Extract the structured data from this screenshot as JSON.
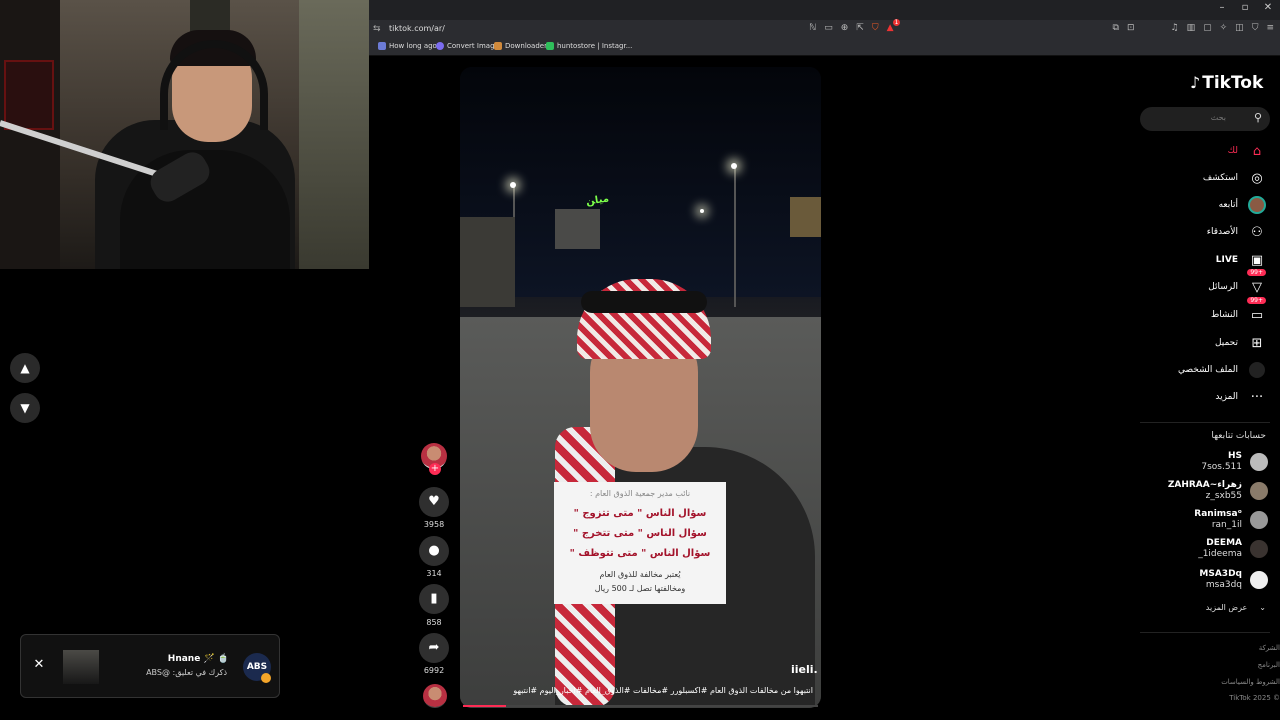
{
  "browser": {
    "url": "tiktok.com/ar/",
    "window_controls": [
      "–",
      "▫",
      "✕"
    ],
    "tab_badge": "1",
    "bookmarks": [
      {
        "label": "How long ago",
        "color": "#6c7bd6"
      },
      {
        "label": "Convert Image",
        "color": "#7b6cf0"
      },
      {
        "label": "Downloader",
        "color": "#d08a3c"
      },
      {
        "label": "huntostore | Instagr...",
        "color": "#2fbf5b"
      }
    ]
  },
  "sidebar": {
    "logo": "TikTok",
    "search_placeholder": "بحث",
    "nav": [
      {
        "label": "لك",
        "icon": "home-icon",
        "glyph": "⌂",
        "active": true
      },
      {
        "label": "استكشف",
        "icon": "compass-icon",
        "glyph": "◎"
      },
      {
        "label": "أتابعه",
        "icon": "following-avatar-icon",
        "glyph": "●"
      },
      {
        "label": "الأصدقاء",
        "icon": "friends-icon",
        "glyph": "👥"
      },
      {
        "label": "LIVE",
        "icon": "live-icon",
        "glyph": "▣"
      },
      {
        "label": "الرسائل",
        "icon": "messages-icon",
        "glyph": "▽",
        "badge": "99+"
      },
      {
        "label": "النشاط",
        "icon": "activity-icon",
        "glyph": "▭",
        "badge": "99+"
      },
      {
        "label": "تحميل",
        "icon": "upload-icon",
        "glyph": "⊞"
      },
      {
        "label": "الملف الشخصي",
        "icon": "profile-icon",
        "glyph": "☺"
      },
      {
        "label": "المزيد",
        "icon": "more-icon",
        "glyph": "···"
      }
    ],
    "following_title": "حسابات تتابعها",
    "following": [
      {
        "name": "HS",
        "handle": "7sos.511",
        "color": "#bbb"
      },
      {
        "name": "ZAHRAA~زهراء",
        "handle": "z_sxb55",
        "color": "#8a7b6a"
      },
      {
        "name": "Ranimsaᵒ",
        "handle": "ran_1il",
        "color": "#999"
      },
      {
        "name": "DEEMA",
        "handle": "_1ideema",
        "color": "#3a3330"
      },
      {
        "name": "MSA3Dq",
        "handle": "msa3dq",
        "color": "#eee"
      }
    ],
    "see_more": "عرض المزيد",
    "footer": [
      "الشركة",
      "البرنامج",
      "الشروط والسياسات",
      "TikTok 2025 ©"
    ]
  },
  "video": {
    "sign_text": "ﻣﯿﺎﻦ",
    "card": {
      "header": "نائب مدير جمعية الذوق العام :",
      "lines": [
        "سؤال الناس \" متى تتزوج \"",
        "سؤال الناس \" متى تتخرج \"",
        "سؤال الناس \" متى تتوظف \""
      ],
      "footer1": "يُعتبر مخالفة للذوق العام",
      "footer2": "ومخالفتها تصل لـ 500 ريال"
    },
    "author": "iieli.",
    "description": "انتبهوا من مخالفات الذوق العام #اكسبلورر #مخالفات #الذوق_العام #اخبار_اليوم #انتبهو",
    "progress": 0.12
  },
  "actions": {
    "likes": "3958",
    "comments": "314",
    "saves": "858",
    "shares": "6992"
  },
  "toast": {
    "name": "Hnane 🪄 🍵",
    "text": "ذكرك في تعليق: @ABS",
    "avatar": "ABS"
  }
}
